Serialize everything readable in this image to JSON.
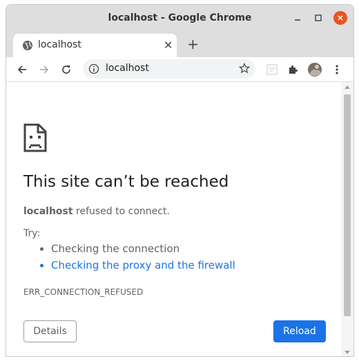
{
  "window": {
    "title": "localhost - Google Chrome"
  },
  "tab": {
    "title": "localhost",
    "close": "✕",
    "new_tab": "+"
  },
  "omnibox": {
    "url": "localhost"
  },
  "page": {
    "heading": "This site can’t be reached",
    "host": "localhost",
    "message": " refused to connect.",
    "try_label": "Try:",
    "suggestions": [
      "Checking the connection",
      "Checking the proxy and the firewall"
    ],
    "error_code": "ERR_CONNECTION_REFUSED",
    "details_button": "Details",
    "reload_button": "Reload"
  },
  "colors": {
    "accent": "#1a73e8",
    "close_button": "#e95420",
    "titlebar": "#dedede"
  },
  "icons": {
    "tab": "globe-icon",
    "back": "back-arrow-icon",
    "forward": "forward-arrow-icon",
    "reload": "reload-icon",
    "info": "info-icon",
    "star": "star-icon",
    "extension": "puzzle-icon",
    "menu": "kebab-menu-icon"
  }
}
